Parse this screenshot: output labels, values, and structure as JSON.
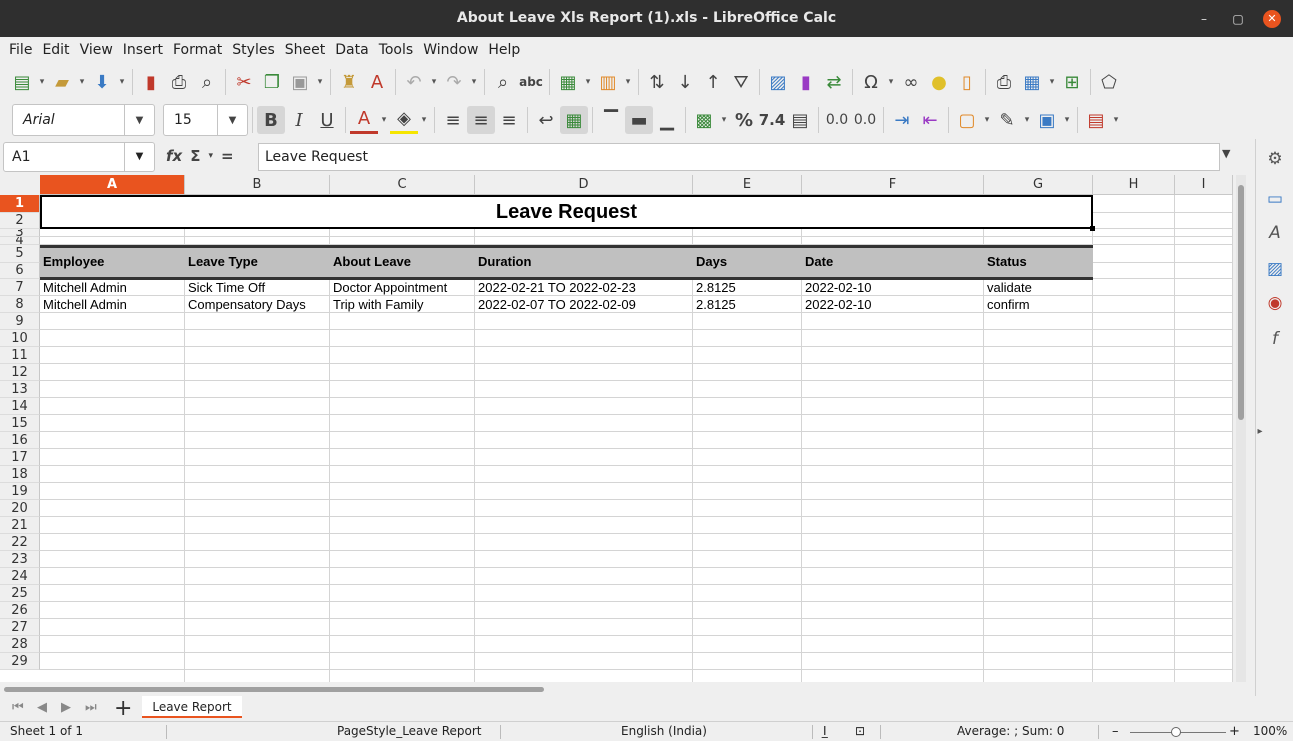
{
  "window": {
    "title": "About Leave Xls Report (1).xls - LibreOffice Calc",
    "minimize": "–",
    "maximize": "▢",
    "close": "✕"
  },
  "menu": [
    "File",
    "Edit",
    "View",
    "Insert",
    "Format",
    "Styles",
    "Sheet",
    "Data",
    "Tools",
    "Window",
    "Help"
  ],
  "toolbar": {
    "font_name": "Arial",
    "font_size": "15",
    "bold": "B",
    "italic": "I",
    "underline": "U",
    "number_format_label": "7.4",
    "percent": "%"
  },
  "formula_bar": {
    "cell_ref": "A1",
    "content": "Leave Request",
    "fx": "fx",
    "sigma": "Σ",
    "equals": "="
  },
  "columns": [
    "A",
    "B",
    "C",
    "D",
    "E",
    "F",
    "G",
    "H",
    "I"
  ],
  "active_column": "A",
  "rows": [
    "1",
    "2",
    "3",
    "4",
    "5",
    "6",
    "7",
    "8",
    "9",
    "10",
    "11",
    "12",
    "13",
    "14",
    "15",
    "16",
    "17",
    "18",
    "19",
    "20",
    "21",
    "22",
    "23",
    "24",
    "25",
    "26",
    "27",
    "28",
    "29"
  ],
  "active_row": "1",
  "sheet": {
    "title": "Leave Request",
    "headers": [
      "Employee",
      "Leave Type",
      "About Leave",
      "Duration",
      "Days",
      "Date",
      "Status"
    ],
    "records": [
      [
        "Mitchell Admin",
        "Sick Time Off",
        "Doctor Appointment",
        "2022-02-21 TO 2022-02-23",
        "2.8125",
        "2022-02-10",
        "validate"
      ],
      [
        "Mitchell Admin",
        "Compensatory Days",
        "Trip with Family",
        "2022-02-07 TO 2022-02-09",
        "2.8125",
        "2022-02-10",
        "confirm"
      ]
    ]
  },
  "tabs": {
    "add": "+",
    "active_tab": "Leave Report"
  },
  "status": {
    "sheet": "Sheet 1 of 1",
    "page_style": "PageStyle_Leave Report",
    "language": "English (India)",
    "sum": "Average: ; Sum: 0",
    "zoom": "100%",
    "zoom_minus": "–",
    "zoom_plus": "+"
  },
  "colors": {
    "accent": "#e9541f",
    "titlebar": "#2f2f2f",
    "header_band": "#c0c0c0"
  }
}
